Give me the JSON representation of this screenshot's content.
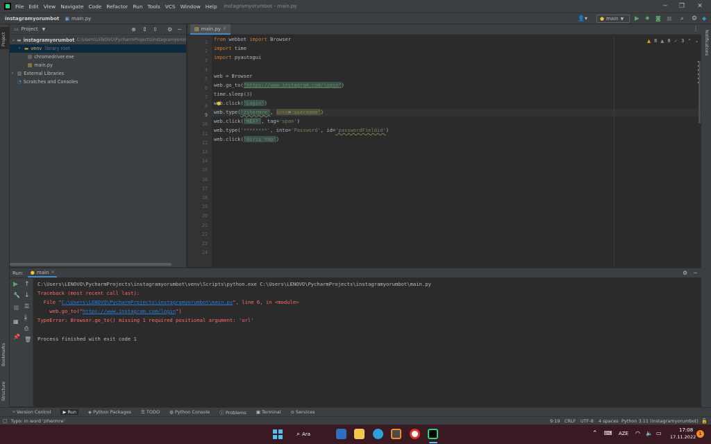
{
  "titlebar": {
    "menu": [
      "File",
      "Edit",
      "View",
      "Navigate",
      "Code",
      "Refactor",
      "Run",
      "Tools",
      "VCS",
      "Window",
      "Help"
    ],
    "title": "instagramyorumbot - main.py"
  },
  "navbar": {
    "project": "instagramyorumbot",
    "file": "main.py",
    "run_config": "main"
  },
  "project_panel": {
    "title": "Project",
    "tree": [
      {
        "label": "instagramyorumbot",
        "note": "C:\\Users\\LENOVO\\PycharmProjects\\instagramyorumbot",
        "level": 0
      },
      {
        "label": "venv",
        "note": "library root",
        "level": 1
      },
      {
        "label": "chromedriver.exe",
        "note": "",
        "level": 2
      },
      {
        "label": "main.py",
        "note": "",
        "level": 2
      },
      {
        "label": "External Libraries",
        "note": "",
        "level": 0
      },
      {
        "label": "Scratches and Consoles",
        "note": "",
        "level": 0
      }
    ]
  },
  "editor": {
    "tab": "main.py",
    "inspection": {
      "warnings": "8",
      "weak": "8",
      "ok": "3"
    },
    "line_numbers": [
      "1",
      "2",
      "3",
      "4",
      "5",
      "6",
      "7",
      "8",
      "9",
      "10",
      "11",
      "12",
      "13",
      "14",
      "15",
      "16",
      "17",
      "18",
      "19",
      "20",
      "21",
      "22",
      "23",
      "24"
    ],
    "code": {
      "l1_from": "from",
      "l1_mod": " webbot ",
      "l1_import": "import",
      "l1_rest": " Browser",
      "l2_import": "import",
      "l2_rest": " time",
      "l3_import": "import",
      "l3_rest": " pyautogui",
      "l5": "web = Browser",
      "l6_a": "web.go_to(",
      "l6_str": "\"https://www.instagram.com/login\"",
      "l6_b": ")",
      "l7_a": "time.sleep(",
      "l7_num": "3",
      "l7_b": ")",
      "l8_a": "web.click(",
      "l8_str": "'Login'",
      "l8_b": ")",
      "l9_a": "web.type(",
      "l9_str": "'zihermre'",
      "l9_b": ", ",
      "l9_c": "into",
      "l9_d": "=",
      "l9_e": "'username'",
      "l9_f": ")",
      "l10_a": "web.click(",
      "l10_str": "'NEXT'",
      "l10_b": ", tag=",
      "l10_c": "'span'",
      "l10_d": ")",
      "l11_a": "web.type(",
      "l11_str": "'********'",
      "l11_b": ", into=",
      "l11_c": "'Password'",
      "l11_d": ", id=",
      "l11_e": "'passwordFieldid'",
      "l11_f": ")",
      "l12_a": "web.click(",
      "l12_str": "'Giriş Yap'",
      "l12_b": ")"
    }
  },
  "run_panel": {
    "label": "Run:",
    "tab": "main",
    "lines": {
      "cmd": "C:\\Users\\LENOVO\\PycharmProjects\\instagramyorumbot\\venv\\Scripts\\python.exe C:\\Users\\LENOVO\\PycharmProjects\\instagramyorumbot\\main.py",
      "tb": "Traceback (most recent call last):",
      "file_a": "  File \"",
      "file_link": "C:\\Users\\LENOVO\\PycharmProjects\\instagramyorumbot\\main.py",
      "file_b": "\", line 6, in <module>",
      "goto_a": "    web.go_to(\"",
      "goto_link": "https://www.instagram.com/login",
      "goto_b": "\")",
      "type_error": "TypeError: Browser.go_to() missing 1 required positional argument: 'url'",
      "finished": "Process finished with exit code 1"
    }
  },
  "bottom_tabs": [
    "Version Control",
    "Run",
    "Python Packages",
    "TODO",
    "Python Console",
    "Problems",
    "Terminal",
    "Services"
  ],
  "statusbar": {
    "message": "Typo: In word 'zihermre'",
    "position": "9:19",
    "line_sep": "CRLF",
    "encoding": "UTF-8",
    "indent": "4 spaces",
    "interpreter": "Python 3.11 (instagramyorumbot)"
  },
  "side_labels": {
    "project": "Project",
    "bookmarks": "Bookmarks",
    "structure": "Structure",
    "notifications": "Notifications"
  },
  "taskbar": {
    "search": "Ara",
    "lang": "AZE",
    "time": "17:08",
    "date": "17.11.2022",
    "badge": "1"
  },
  "colors": {
    "accent": "#3592c4",
    "keyword": "#cc7832",
    "string": "#6a8759",
    "error": "#ff6b68",
    "run_green": "#59a869"
  }
}
